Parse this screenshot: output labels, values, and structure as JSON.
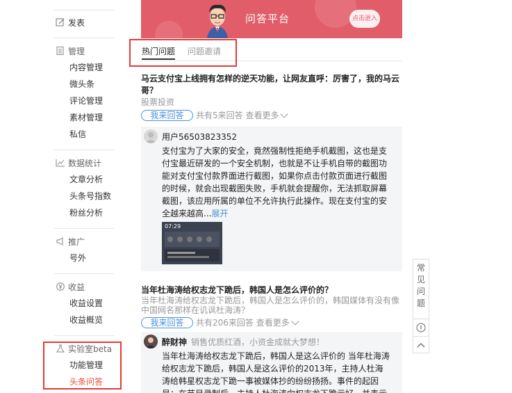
{
  "sidebar": {
    "publish": "发表",
    "manage": {
      "title": "管理",
      "items": [
        "内容管理",
        "微头条",
        "评论管理",
        "素材管理",
        "私信"
      ]
    },
    "stats": {
      "title": "数据统计",
      "items": [
        "文章分析",
        "头条号指数",
        "粉丝分析"
      ]
    },
    "promote": {
      "title": "推广",
      "items": [
        "号外"
      ]
    },
    "income": {
      "title": "收益",
      "items": [
        "收益设置",
        "收益概览"
      ]
    },
    "lab": {
      "title": "实验室beta",
      "items": [
        "功能管理",
        "头条问答"
      ]
    }
  },
  "banner": {
    "title": "问答平台",
    "enter_button": "点击进入"
  },
  "tabs": [
    "热门问题",
    "问题邀请"
  ],
  "questions": [
    {
      "title": "马云支付宝上线拥有怎样的逆天功能，让网友直呼：厉害了，我的马云哥？",
      "tag": "股票投资",
      "answer_btn": "我来回答",
      "count": "共有5来回答",
      "more": "查看更多",
      "answer": {
        "user": "用户56503823352",
        "text": "支付宝为了大家的安全，竟然强制性拒绝手机截图，这也是支付宝最近研发的一个安全机制，也就是不让手机自带的截图功能对支付宝付款界面进行截图，如果你点击付款页面进行截图的时候，就会出现截图失败，手机就会提醒你，无法抓取屏幕截图，该应用所属的单位不允许执行此操作。现在支付宝的安全越来越高...",
        "expand": "展开"
      }
    },
    {
      "title": "当年杜海涛给权志龙下跪后，韩国人是怎么评价的？",
      "snippet": "当年杜海涛给权志龙下跪后，韩国人是怎么评价的，韩国媒体有没有像中国网名那样在讥讽杜海涛？",
      "answer_btn": "我来回答",
      "count": "共有206来回答",
      "more": "查看更多",
      "answer": {
        "user": "醉财神",
        "slogan": "销售优质红酒，小资金成就大梦想！",
        "text": "当年杜海涛给权志龙下跪后，韩国人是这么评价的 当年杜海涛给权志龙下跪后，韩国人是这么评价的2013年，主持人杜海涛给韩星权志龙下跪一事被媒体抄的纷纷扬扬。事件的起因是：在节目录制后，主持人杜海涛向权志龙下跪示好，并表示对其非常崇拜。"
      }
    }
  ],
  "faq": {
    "label": "常见问题"
  }
}
